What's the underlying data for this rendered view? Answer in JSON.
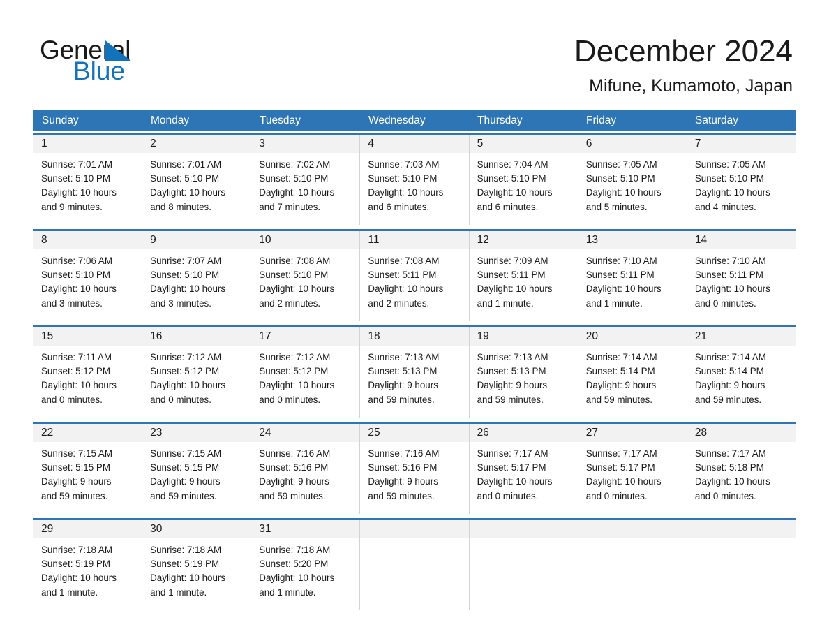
{
  "brand": {
    "name_part1": "General",
    "name_part2": "Blue",
    "accent_color": "#1272ba"
  },
  "header": {
    "title": "December 2024",
    "subtitle": "Mifune, Kumamoto, Japan",
    "header_bg_color": "#2e75b6"
  },
  "calendar": {
    "weekday_headers": [
      "Sunday",
      "Monday",
      "Tuesday",
      "Wednesday",
      "Thursday",
      "Friday",
      "Saturday"
    ],
    "weeks": [
      [
        {
          "day": "1",
          "sunrise": "Sunrise: 7:01 AM",
          "sunset": "Sunset: 5:10 PM",
          "daylight1": "Daylight: 10 hours",
          "daylight2": "and 9 minutes."
        },
        {
          "day": "2",
          "sunrise": "Sunrise: 7:01 AM",
          "sunset": "Sunset: 5:10 PM",
          "daylight1": "Daylight: 10 hours",
          "daylight2": "and 8 minutes."
        },
        {
          "day": "3",
          "sunrise": "Sunrise: 7:02 AM",
          "sunset": "Sunset: 5:10 PM",
          "daylight1": "Daylight: 10 hours",
          "daylight2": "and 7 minutes."
        },
        {
          "day": "4",
          "sunrise": "Sunrise: 7:03 AM",
          "sunset": "Sunset: 5:10 PM",
          "daylight1": "Daylight: 10 hours",
          "daylight2": "and 6 minutes."
        },
        {
          "day": "5",
          "sunrise": "Sunrise: 7:04 AM",
          "sunset": "Sunset: 5:10 PM",
          "daylight1": "Daylight: 10 hours",
          "daylight2": "and 6 minutes."
        },
        {
          "day": "6",
          "sunrise": "Sunrise: 7:05 AM",
          "sunset": "Sunset: 5:10 PM",
          "daylight1": "Daylight: 10 hours",
          "daylight2": "and 5 minutes."
        },
        {
          "day": "7",
          "sunrise": "Sunrise: 7:05 AM",
          "sunset": "Sunset: 5:10 PM",
          "daylight1": "Daylight: 10 hours",
          "daylight2": "and 4 minutes."
        }
      ],
      [
        {
          "day": "8",
          "sunrise": "Sunrise: 7:06 AM",
          "sunset": "Sunset: 5:10 PM",
          "daylight1": "Daylight: 10 hours",
          "daylight2": "and 3 minutes."
        },
        {
          "day": "9",
          "sunrise": "Sunrise: 7:07 AM",
          "sunset": "Sunset: 5:10 PM",
          "daylight1": "Daylight: 10 hours",
          "daylight2": "and 3 minutes."
        },
        {
          "day": "10",
          "sunrise": "Sunrise: 7:08 AM",
          "sunset": "Sunset: 5:10 PM",
          "daylight1": "Daylight: 10 hours",
          "daylight2": "and 2 minutes."
        },
        {
          "day": "11",
          "sunrise": "Sunrise: 7:08 AM",
          "sunset": "Sunset: 5:11 PM",
          "daylight1": "Daylight: 10 hours",
          "daylight2": "and 2 minutes."
        },
        {
          "day": "12",
          "sunrise": "Sunrise: 7:09 AM",
          "sunset": "Sunset: 5:11 PM",
          "daylight1": "Daylight: 10 hours",
          "daylight2": "and 1 minute."
        },
        {
          "day": "13",
          "sunrise": "Sunrise: 7:10 AM",
          "sunset": "Sunset: 5:11 PM",
          "daylight1": "Daylight: 10 hours",
          "daylight2": "and 1 minute."
        },
        {
          "day": "14",
          "sunrise": "Sunrise: 7:10 AM",
          "sunset": "Sunset: 5:11 PM",
          "daylight1": "Daylight: 10 hours",
          "daylight2": "and 0 minutes."
        }
      ],
      [
        {
          "day": "15",
          "sunrise": "Sunrise: 7:11 AM",
          "sunset": "Sunset: 5:12 PM",
          "daylight1": "Daylight: 10 hours",
          "daylight2": "and 0 minutes."
        },
        {
          "day": "16",
          "sunrise": "Sunrise: 7:12 AM",
          "sunset": "Sunset: 5:12 PM",
          "daylight1": "Daylight: 10 hours",
          "daylight2": "and 0 minutes."
        },
        {
          "day": "17",
          "sunrise": "Sunrise: 7:12 AM",
          "sunset": "Sunset: 5:12 PM",
          "daylight1": "Daylight: 10 hours",
          "daylight2": "and 0 minutes."
        },
        {
          "day": "18",
          "sunrise": "Sunrise: 7:13 AM",
          "sunset": "Sunset: 5:13 PM",
          "daylight1": "Daylight: 9 hours",
          "daylight2": "and 59 minutes."
        },
        {
          "day": "19",
          "sunrise": "Sunrise: 7:13 AM",
          "sunset": "Sunset: 5:13 PM",
          "daylight1": "Daylight: 9 hours",
          "daylight2": "and 59 minutes."
        },
        {
          "day": "20",
          "sunrise": "Sunrise: 7:14 AM",
          "sunset": "Sunset: 5:14 PM",
          "daylight1": "Daylight: 9 hours",
          "daylight2": "and 59 minutes."
        },
        {
          "day": "21",
          "sunrise": "Sunrise: 7:14 AM",
          "sunset": "Sunset: 5:14 PM",
          "daylight1": "Daylight: 9 hours",
          "daylight2": "and 59 minutes."
        }
      ],
      [
        {
          "day": "22",
          "sunrise": "Sunrise: 7:15 AM",
          "sunset": "Sunset: 5:15 PM",
          "daylight1": "Daylight: 9 hours",
          "daylight2": "and 59 minutes."
        },
        {
          "day": "23",
          "sunrise": "Sunrise: 7:15 AM",
          "sunset": "Sunset: 5:15 PM",
          "daylight1": "Daylight: 9 hours",
          "daylight2": "and 59 minutes."
        },
        {
          "day": "24",
          "sunrise": "Sunrise: 7:16 AM",
          "sunset": "Sunset: 5:16 PM",
          "daylight1": "Daylight: 9 hours",
          "daylight2": "and 59 minutes."
        },
        {
          "day": "25",
          "sunrise": "Sunrise: 7:16 AM",
          "sunset": "Sunset: 5:16 PM",
          "daylight1": "Daylight: 9 hours",
          "daylight2": "and 59 minutes."
        },
        {
          "day": "26",
          "sunrise": "Sunrise: 7:17 AM",
          "sunset": "Sunset: 5:17 PM",
          "daylight1": "Daylight: 10 hours",
          "daylight2": "and 0 minutes."
        },
        {
          "day": "27",
          "sunrise": "Sunrise: 7:17 AM",
          "sunset": "Sunset: 5:17 PM",
          "daylight1": "Daylight: 10 hours",
          "daylight2": "and 0 minutes."
        },
        {
          "day": "28",
          "sunrise": "Sunrise: 7:17 AM",
          "sunset": "Sunset: 5:18 PM",
          "daylight1": "Daylight: 10 hours",
          "daylight2": "and 0 minutes."
        }
      ],
      [
        {
          "day": "29",
          "sunrise": "Sunrise: 7:18 AM",
          "sunset": "Sunset: 5:19 PM",
          "daylight1": "Daylight: 10 hours",
          "daylight2": "and 1 minute."
        },
        {
          "day": "30",
          "sunrise": "Sunrise: 7:18 AM",
          "sunset": "Sunset: 5:19 PM",
          "daylight1": "Daylight: 10 hours",
          "daylight2": "and 1 minute."
        },
        {
          "day": "31",
          "sunrise": "Sunrise: 7:18 AM",
          "sunset": "Sunset: 5:20 PM",
          "daylight1": "Daylight: 10 hours",
          "daylight2": "and 1 minute."
        },
        {
          "day": "",
          "sunrise": "",
          "sunset": "",
          "daylight1": "",
          "daylight2": ""
        },
        {
          "day": "",
          "sunrise": "",
          "sunset": "",
          "daylight1": "",
          "daylight2": ""
        },
        {
          "day": "",
          "sunrise": "",
          "sunset": "",
          "daylight1": "",
          "daylight2": ""
        },
        {
          "day": "",
          "sunrise": "",
          "sunset": "",
          "daylight1": "",
          "daylight2": ""
        }
      ]
    ]
  }
}
